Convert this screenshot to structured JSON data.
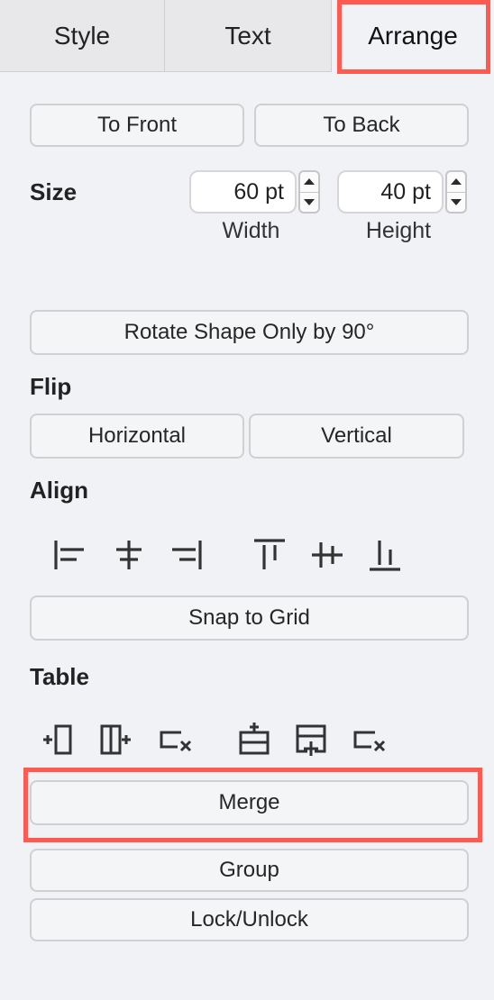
{
  "tabs": [
    {
      "label": "Style"
    },
    {
      "label": "Text"
    },
    {
      "label": "Arrange"
    }
  ],
  "order": {
    "to_front": "To Front",
    "to_back": "To Back"
  },
  "size": {
    "label": "Size",
    "width": {
      "value": "60 pt",
      "label": "Width"
    },
    "height": {
      "value": "40 pt",
      "label": "Height"
    }
  },
  "rotate_label": "Rotate Shape Only by 90°",
  "flip": {
    "label": "Flip",
    "horizontal": "Horizontal",
    "vertical": "Vertical"
  },
  "align": {
    "label": "Align",
    "icons": [
      "align-left-icon",
      "align-center-icon",
      "align-right-icon",
      "align-top-icon",
      "align-middle-icon",
      "align-bottom-icon"
    ]
  },
  "snap_label": "Snap to Grid",
  "table": {
    "label": "Table",
    "icons": [
      "insert-column-before-icon",
      "insert-column-after-icon",
      "delete-column-icon",
      "insert-row-before-icon",
      "insert-row-after-icon",
      "delete-row-icon"
    ]
  },
  "merge_label": "Merge",
  "group_label": "Group",
  "lock_label": "Lock/Unlock",
  "colors": {
    "highlight": "#ff5a4f",
    "panel_bg": "#f1f2f5"
  }
}
